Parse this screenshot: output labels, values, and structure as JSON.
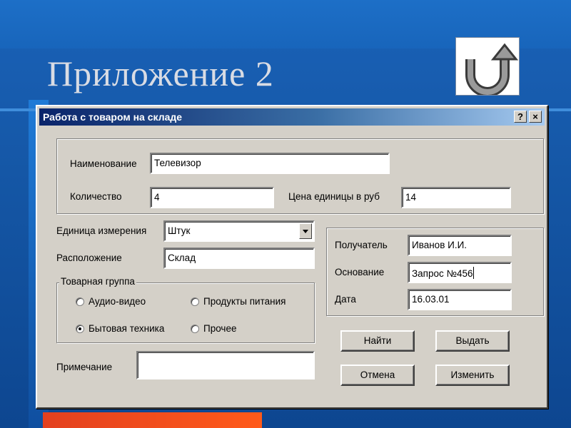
{
  "slide": {
    "title": "Приложение 2"
  },
  "dialog": {
    "title": "Работа с товаром на складе",
    "help_label": "?",
    "close_label": "×",
    "product": {
      "name_label": "Наименование",
      "name_value": "Телевизор",
      "quantity_label": "Количество",
      "quantity_value": "4",
      "price_label": "Цена единицы в руб",
      "price_value": "14"
    },
    "unit_label": "Единица измерения",
    "unit_value": "Штук",
    "location_label": "Расположение",
    "location_value": "Склад",
    "group": {
      "caption": "Товарная группа",
      "options": [
        "Аудио-видео",
        "Продукты питания",
        "Бытовая техника",
        "Прочее"
      ],
      "selected": "Бытовая техника"
    },
    "note_label": "Примечание",
    "note_value": "",
    "recipient_label": "Получатель",
    "recipient_value": "Иванов И.И.",
    "basis_label": "Основание",
    "basis_value": "Запрос №456",
    "date_label": "Дата",
    "date_value": "16.03.01",
    "buttons": {
      "find": "Найти",
      "issue": "Выдать",
      "cancel": "Отмена",
      "change": "Изменить"
    }
  },
  "colors": {
    "background": "#1557a6",
    "titlebar": "#0a246a",
    "dialog": "#d4d0c8",
    "accent_strip": "#e3401f"
  }
}
